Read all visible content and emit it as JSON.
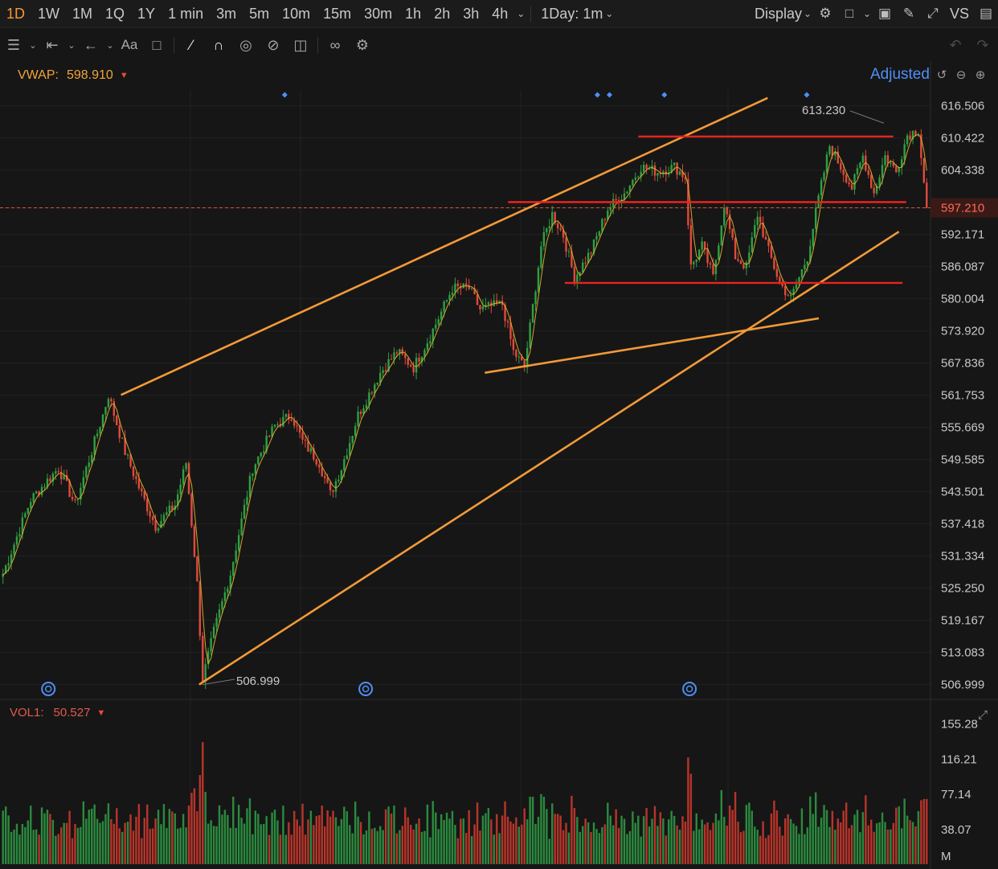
{
  "toolbar": {
    "timeframes": [
      "1D",
      "1W",
      "1M",
      "1Q",
      "1Y",
      "1 min",
      "3m",
      "5m",
      "10m",
      "15m",
      "30m",
      "1h",
      "2h",
      "3h",
      "4h"
    ],
    "active": "1D",
    "interval_select": "1Day: 1m",
    "display_label": "Display",
    "vs_label": "VS"
  },
  "legend": {
    "vwap_label": "VWAP:",
    "vwap_value": "598.910",
    "adjusted_label": "Adjusted"
  },
  "volume_legend": {
    "label": "VOL1:",
    "value": "50.527"
  },
  "colors": {
    "up": "#2ea043",
    "down": "#e04a3c",
    "trend": "#f29a38",
    "level": "#e8231f",
    "vwap": "#e6b52f",
    "marker": "#4f8ff7"
  },
  "chart_data": {
    "type": "candlestick",
    "price_axis": {
      "ticks": [
        "616.506",
        "610.422",
        "604.338",
        "597.210",
        "592.171",
        "586.087",
        "580.004",
        "573.920",
        "567.836",
        "561.753",
        "555.669",
        "549.585",
        "543.501",
        "537.418",
        "531.334",
        "525.250",
        "519.167",
        "513.083",
        "506.999"
      ],
      "current_price": "597.210",
      "range": [
        504.5,
        619.5
      ]
    },
    "volume_axis": {
      "ticks": [
        "155.28",
        "116.21",
        "77.14",
        "38.07"
      ],
      "unit": "M",
      "range": [
        0,
        160
      ]
    },
    "annotations": {
      "high_label": "613.230",
      "low_label": "506.999",
      "high_value": 613.23,
      "low_value": 506.999
    },
    "anchors": [
      {
        "i": 0,
        "v": 528
      },
      {
        "i": 10,
        "v": 542
      },
      {
        "i": 20,
        "v": 548
      },
      {
        "i": 26,
        "v": 541
      },
      {
        "i": 36,
        "v": 558
      },
      {
        "i": 38,
        "v": 561.8
      },
      {
        "i": 44,
        "v": 551
      },
      {
        "i": 50,
        "v": 543
      },
      {
        "i": 55,
        "v": 537
      },
      {
        "i": 62,
        "v": 541
      },
      {
        "i": 66,
        "v": 549
      },
      {
        "i": 70,
        "v": 526
      },
      {
        "i": 72,
        "v": 508
      },
      {
        "i": 76,
        "v": 517
      },
      {
        "i": 82,
        "v": 528
      },
      {
        "i": 90,
        "v": 548
      },
      {
        "i": 98,
        "v": 556
      },
      {
        "i": 104,
        "v": 558
      },
      {
        "i": 108,
        "v": 553
      },
      {
        "i": 114,
        "v": 549
      },
      {
        "i": 118,
        "v": 543
      },
      {
        "i": 122,
        "v": 548
      },
      {
        "i": 128,
        "v": 558
      },
      {
        "i": 136,
        "v": 566
      },
      {
        "i": 142,
        "v": 570
      },
      {
        "i": 148,
        "v": 567
      },
      {
        "i": 154,
        "v": 573
      },
      {
        "i": 162,
        "v": 582
      },
      {
        "i": 168,
        "v": 582
      },
      {
        "i": 172,
        "v": 578
      },
      {
        "i": 180,
        "v": 579
      },
      {
        "i": 184,
        "v": 570
      },
      {
        "i": 188,
        "v": 567
      },
      {
        "i": 194,
        "v": 590
      },
      {
        "i": 198,
        "v": 596
      },
      {
        "i": 202,
        "v": 592
      },
      {
        "i": 206,
        "v": 584
      },
      {
        "i": 212,
        "v": 589
      },
      {
        "i": 218,
        "v": 597
      },
      {
        "i": 224,
        "v": 600
      },
      {
        "i": 230,
        "v": 605
      },
      {
        "i": 236,
        "v": 604
      },
      {
        "i": 242,
        "v": 605
      },
      {
        "i": 246,
        "v": 603
      },
      {
        "i": 248,
        "v": 586
      },
      {
        "i": 252,
        "v": 590
      },
      {
        "i": 256,
        "v": 584
      },
      {
        "i": 260,
        "v": 598
      },
      {
        "i": 264,
        "v": 588
      },
      {
        "i": 268,
        "v": 586
      },
      {
        "i": 272,
        "v": 596
      },
      {
        "i": 276,
        "v": 589
      },
      {
        "i": 280,
        "v": 583
      },
      {
        "i": 284,
        "v": 580
      },
      {
        "i": 290,
        "v": 588
      },
      {
        "i": 294,
        "v": 599
      },
      {
        "i": 298,
        "v": 609
      },
      {
        "i": 302,
        "v": 605
      },
      {
        "i": 306,
        "v": 601
      },
      {
        "i": 310,
        "v": 607
      },
      {
        "i": 314,
        "v": 600
      },
      {
        "i": 318,
        "v": 607
      },
      {
        "i": 322,
        "v": 604
      },
      {
        "i": 326,
        "v": 611
      },
      {
        "i": 330,
        "v": 612
      },
      {
        "i": 333,
        "v": 597.2
      }
    ],
    "trend_lines": [
      {
        "color": "trend",
        "from": [
          0.13,
          561.8
        ],
        "to": [
          0.825,
          618.0
        ]
      },
      {
        "color": "trend",
        "from": [
          0.214,
          507.0
        ],
        "to": [
          0.966,
          592.7
        ]
      },
      {
        "color": "trend",
        "from": [
          0.521,
          566.0
        ],
        "to": [
          0.88,
          576.3
        ]
      },
      {
        "color": "level",
        "from": [
          0.546,
          598.3
        ],
        "to": [
          0.974,
          598.3
        ]
      },
      {
        "color": "level",
        "from": [
          0.686,
          610.7
        ],
        "to": [
          0.96,
          610.7
        ]
      },
      {
        "color": "level",
        "from": [
          0.607,
          583.0
        ],
        "to": [
          0.97,
          583.0
        ]
      }
    ],
    "event_markers_top": [
      0.306,
      0.642,
      0.655,
      0.714,
      0.867
    ],
    "event_markers_bottom": [
      0.052,
      0.393,
      0.741
    ]
  }
}
